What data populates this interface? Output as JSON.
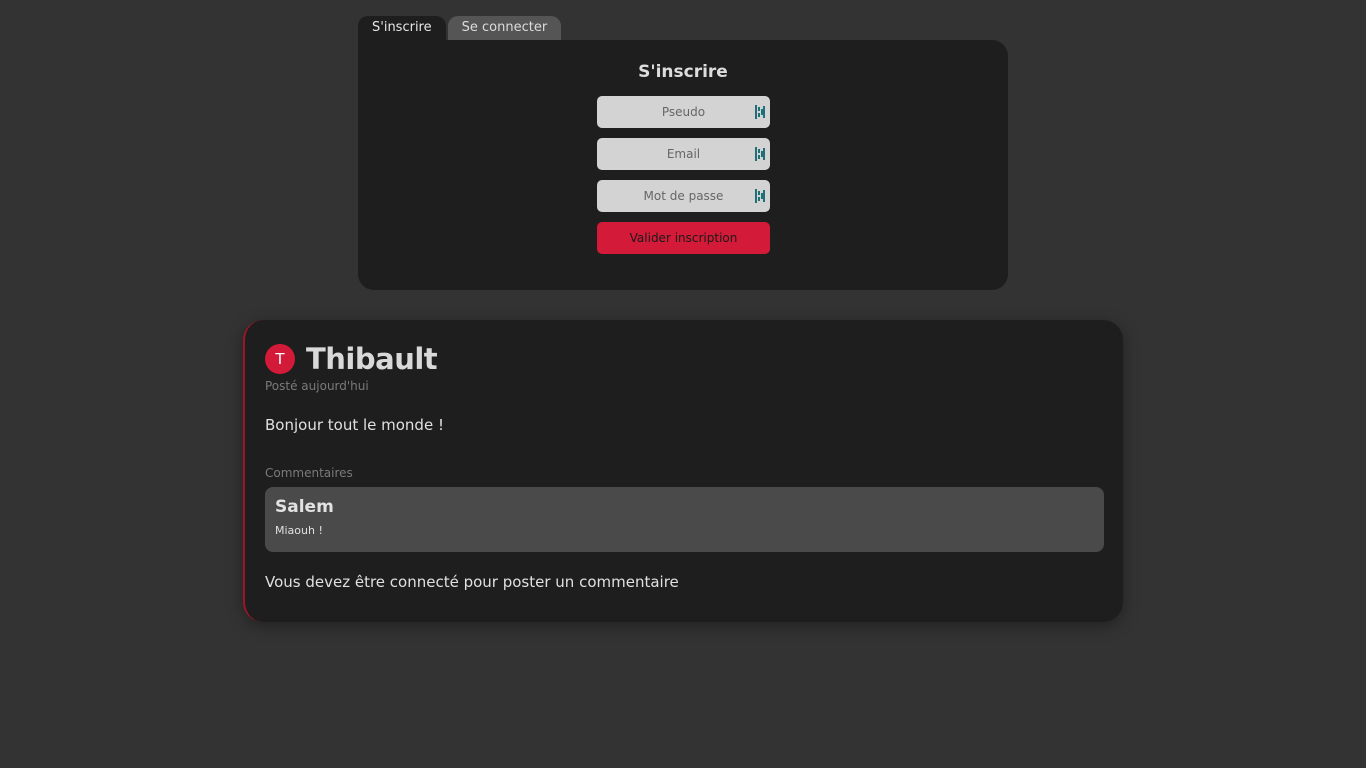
{
  "tabs": {
    "signup": "S'inscrire",
    "login": "Se connecter"
  },
  "signup_form": {
    "title": "S'inscrire",
    "pseudo_placeholder": "Pseudo",
    "email_placeholder": "Email",
    "password_placeholder": "Mot de passe",
    "submit_label": "Valider inscription"
  },
  "post": {
    "avatar_letter": "T",
    "author": "Thibault",
    "date": "Posté aujourd'hui",
    "body": "Bonjour tout le monde !",
    "comments_label": "Commentaires",
    "comments": [
      {
        "author": "Salem",
        "text": "Miaouh !"
      }
    ],
    "login_notice": "Vous devez être connecté pour poster un commentaire"
  },
  "colors": {
    "background": "#333333",
    "card": "#1e1e1e",
    "accent": "#d31a38",
    "field": "#d3d3d3",
    "comment": "#4a4a4a"
  },
  "icons": {
    "field_icon": "password-manager-icon"
  }
}
